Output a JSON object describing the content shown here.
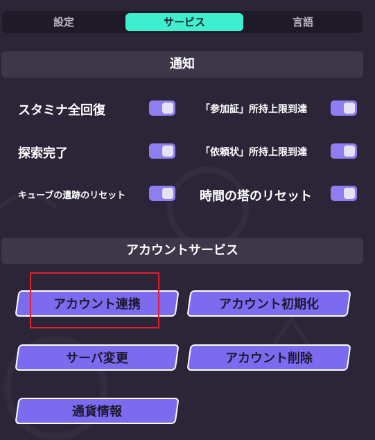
{
  "tabs": [
    {
      "label": "設定",
      "active": false
    },
    {
      "label": "サービス",
      "active": true
    },
    {
      "label": "言語",
      "active": false
    }
  ],
  "notification": {
    "header": "通知",
    "settings": [
      {
        "label": "スタミナ全回復",
        "on": true
      },
      {
        "label": "「参加証」所持上限到達",
        "on": true
      },
      {
        "label": "探索完了",
        "on": true
      },
      {
        "label": "「依頼状」所持上限到達",
        "on": true
      },
      {
        "label": "キューブの遺跡のリセット",
        "on": true
      },
      {
        "label": "時間の塔のリセット",
        "on": true
      }
    ]
  },
  "account": {
    "header": "アカウントサービス",
    "buttons": {
      "link": "アカウント連携",
      "reset": "アカウント初期化",
      "server_change": "サーバ変更",
      "delete": "アカウント削除",
      "currency_info": "通貨情報"
    }
  },
  "colors": {
    "background": "#2c2538",
    "active_tab": "#3ff0d0",
    "toggle_on": "#8f7ef0",
    "button": "#7c6bef",
    "highlight": "#e0202e"
  }
}
